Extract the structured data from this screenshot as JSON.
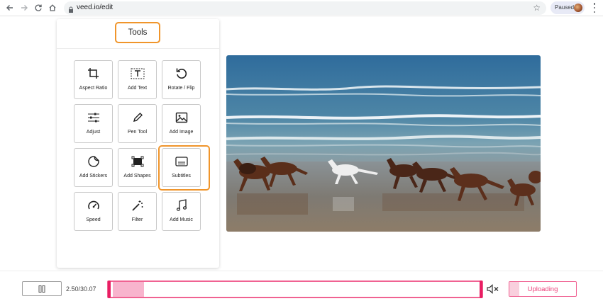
{
  "browser": {
    "url": "veed.io/edit",
    "profile_status": "Paused"
  },
  "tools_panel": {
    "title": "Tools",
    "tools": [
      {
        "label": "Aspect Ratio",
        "icon": "crop-icon"
      },
      {
        "label": "Add Text",
        "icon": "text-icon"
      },
      {
        "label": "Rotate / Flip",
        "icon": "rotate-icon"
      },
      {
        "label": "Adjust",
        "icon": "sliders-icon"
      },
      {
        "label": "Pen Tool",
        "icon": "pen-icon"
      },
      {
        "label": "Add Image",
        "icon": "image-icon"
      },
      {
        "label": "Add Stickers",
        "icon": "sticker-icon"
      },
      {
        "label": "Add Shapes",
        "icon": "shapes-icon"
      },
      {
        "label": "Subtitles",
        "icon": "subtitles-icon"
      },
      {
        "label": "Speed",
        "icon": "speedometer-icon"
      },
      {
        "label": "Filter",
        "icon": "magic-wand-icon"
      },
      {
        "label": "Add Music",
        "icon": "music-icon"
      }
    ],
    "highlighted_tool": "Subtitles"
  },
  "player": {
    "time": "2.50/30.07",
    "progress_fraction": 0.083,
    "muted": true
  },
  "upload": {
    "label": "Uploading",
    "progress_fraction": 0.15
  },
  "colors": {
    "highlight": "#f0952b",
    "accent": "#f06292",
    "timeline_fill": "#f8b4cd"
  }
}
